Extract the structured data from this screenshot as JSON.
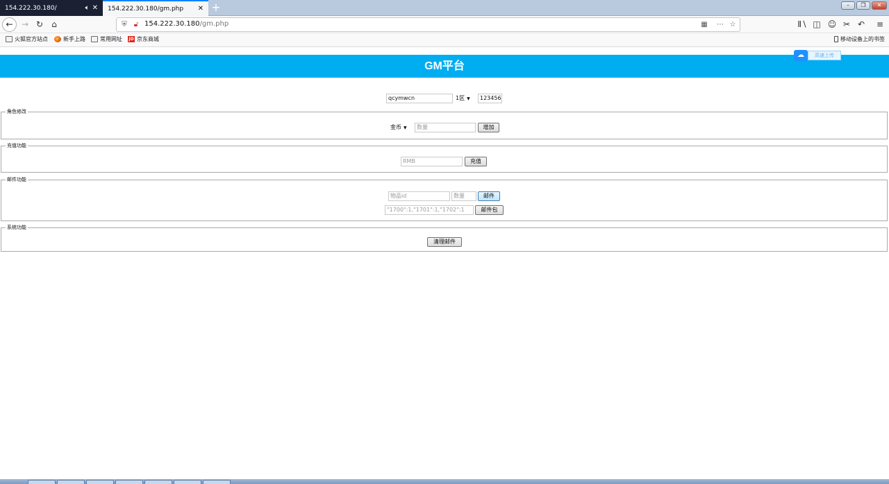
{
  "browser": {
    "tabs": [
      {
        "title": "154.222.30.180/",
        "active": false,
        "audio": true
      },
      {
        "title": "154.222.30.180/gm.php",
        "active": true,
        "audio": false
      }
    ],
    "new_tab_glyph": "+",
    "window_controls": [
      "minimize-icon",
      "restore-icon",
      "close-icon"
    ],
    "url_host": "154.222.30.180",
    "url_path": "/gm.php",
    "bookmarks": [
      {
        "label": "火狐官方站点",
        "icon": "folder-icon"
      },
      {
        "label": "新手上路",
        "icon": "firefox-icon"
      },
      {
        "label": "常用网址",
        "icon": "folder-icon"
      },
      {
        "label": "京东商城",
        "icon": "jd-icon"
      }
    ],
    "mobile_bookmarks": "移动设备上的书签"
  },
  "page": {
    "title": "GM平台",
    "upload_label": "高速上传",
    "top_form": {
      "account_value": "qcymwcn",
      "server_selected": "1区",
      "password_value": "123456"
    },
    "sections": {
      "role": {
        "legend": "角色修改",
        "currency_selected": "金币",
        "amount_placeholder": "数量",
        "add_button": "增加"
      },
      "recharge": {
        "legend": "充值功能",
        "rmb_placeholder": "RMB",
        "recharge_button": "充值"
      },
      "mail": {
        "legend": "邮件功能",
        "item_id_placeholder": "物品id",
        "quantity_placeholder": "数量",
        "mail_button": "邮件",
        "package_placeholder": "\"1700\":1,\"1701\":1,\"1702\":1",
        "package_button": "邮件包"
      },
      "system": {
        "legend": "系统功能",
        "clear_mail_button": "清理邮件"
      }
    }
  },
  "colors": {
    "header_bg": "#00adf0",
    "active_tab_accent": "#0a84ff",
    "inactive_tab_bg": "#1c2033"
  }
}
